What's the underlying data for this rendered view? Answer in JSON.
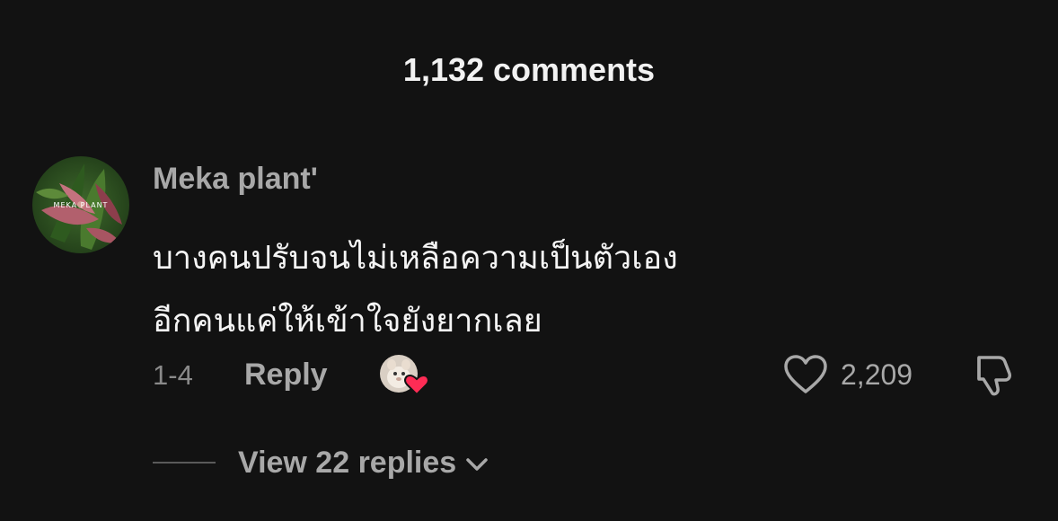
{
  "header": {
    "title": "1,132 comments"
  },
  "comment": {
    "author": "Meka plant'",
    "avatar_text": "MEKA PLANT",
    "lines": [
      "บางคนปรับจนไม่เหลือความเป็นตัวเอง",
      "อีกคนแค่ให้เข้าใจยังยากเลย"
    ],
    "time": "1-4",
    "reply_label": "Reply",
    "like_count": "2,209",
    "view_replies_label": "View 22 replies"
  },
  "icons": {
    "like": "heart-outline-icon",
    "dislike": "thumbs-down-icon",
    "creator_like": "creator-liked-heart-icon",
    "view_replies": "chevron-down-icon"
  },
  "colors": {
    "background": "#121212",
    "primary_text": "#f4f4f4",
    "secondary_text": "#a8a8a8",
    "creator_heart": "#fe2c55"
  }
}
